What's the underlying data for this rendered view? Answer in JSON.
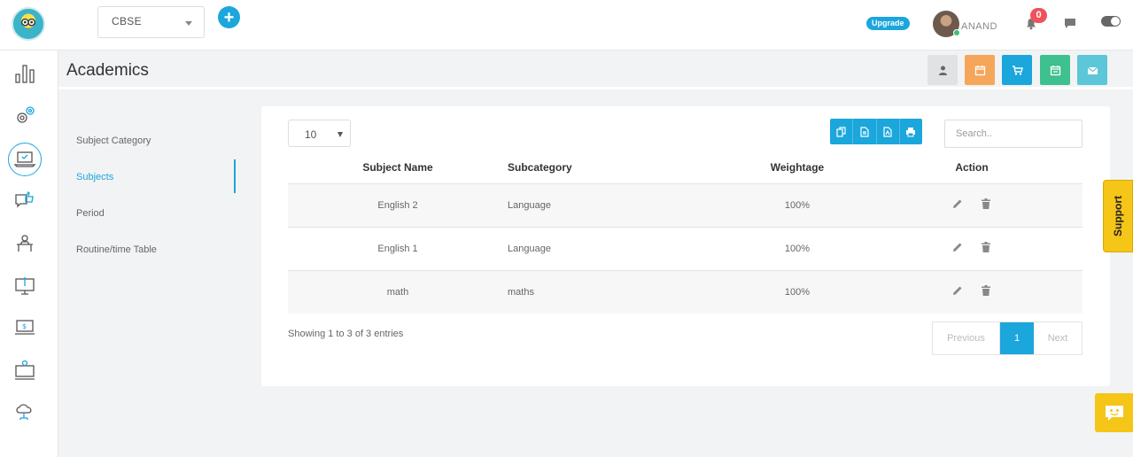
{
  "header": {
    "board_select": "CBSE",
    "upgrade_label": "Upgrade",
    "username": "ANAND",
    "notification_count": "0"
  },
  "page": {
    "title": "Academics"
  },
  "subnav": {
    "items": [
      {
        "label": "Subject Category"
      },
      {
        "label": "Subjects"
      },
      {
        "label": "Period"
      },
      {
        "label": "Routine/time Table"
      }
    ],
    "active_index": 1
  },
  "table_controls": {
    "page_length": "10",
    "search_placeholder": "Search.."
  },
  "table": {
    "headers": [
      "Subject Name",
      "Subcategory",
      "Weightage",
      "Action"
    ],
    "rows": [
      {
        "subject": "English 2",
        "subcategory": "Language",
        "weightage": "100%"
      },
      {
        "subject": "English 1",
        "subcategory": "Language",
        "weightage": "100%"
      },
      {
        "subject": "math",
        "subcategory": "maths",
        "weightage": "100%"
      }
    ]
  },
  "footer": {
    "info": "Showing 1 to 3 of 3 entries",
    "prev_label": "Previous",
    "current_page": "1",
    "next_label": "Next"
  },
  "support_label": "Support",
  "colors": {
    "accent": "#1ba6dc",
    "orange": "#f5a65b",
    "green": "#3ec08f",
    "teal": "#5cc7d8",
    "support_yellow": "#f5c518"
  },
  "icons": {
    "header_buttons": [
      "user-icon",
      "calendar-icon",
      "cart-icon",
      "calendar-check-icon",
      "envelope-icon"
    ],
    "sidebar": [
      "bar-chart-icon",
      "gears-icon",
      "laptop-check-icon",
      "thumbs-up-chat-icon",
      "desk-icon",
      "monitor-clip-icon",
      "monitor-dollar-icon",
      "monitor-person-icon",
      "cloud-network-icon"
    ],
    "export": [
      "copy-icon",
      "csv-icon",
      "pdf-icon",
      "print-icon"
    ]
  }
}
